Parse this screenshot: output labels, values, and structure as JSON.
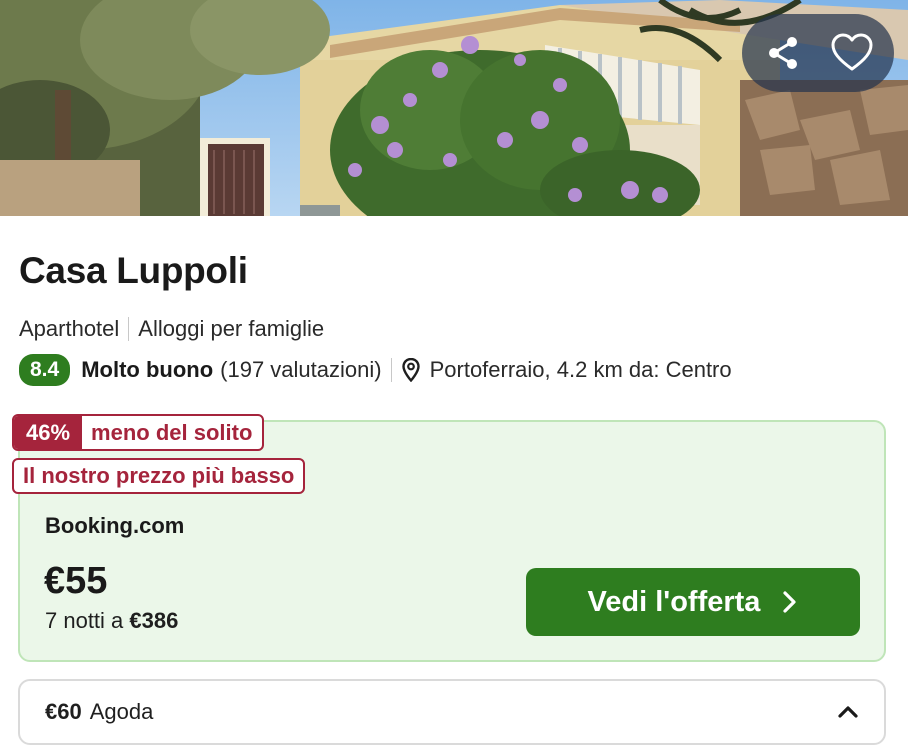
{
  "hero": {
    "image_alt": "Casa Luppoli",
    "share_icon": "share-icon",
    "favorite_icon": "heart-icon"
  },
  "hotel": {
    "name": "Casa Luppoli",
    "type": "Aparthotel",
    "category": "Alloggi per famiglie",
    "rating_score": "8.4",
    "rating_label": "Molto buono",
    "rating_count": "(197 valutazioni)",
    "location": "Portoferraio, 4.2 km da: Centro"
  },
  "deal": {
    "discount_pct": "46%",
    "discount_text": "meno del solito",
    "lowest_price_badge": "Il nostro prezzo più basso",
    "provider": "Booking.com",
    "price": "€55",
    "total_prefix": "7 notti a",
    "total_price": "€386",
    "cta_label": "Vedi l'offerta"
  },
  "alternative": {
    "price": "€60",
    "provider": "Agoda"
  },
  "colors": {
    "accent_green": "#2e7d1f",
    "deal_bg": "#ebf7e9",
    "badge_red": "#a5243c"
  }
}
